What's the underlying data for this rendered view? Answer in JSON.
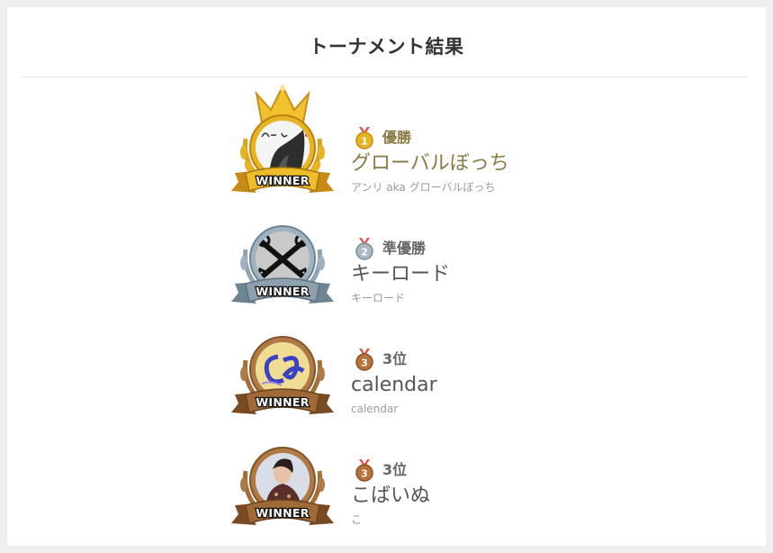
{
  "title": "トーナメント結果",
  "entries": [
    {
      "rank_label": "優勝",
      "name": "グローバルぼっち",
      "sub": "アンリ aka グローバルぼっち",
      "tier": "gold",
      "medal_number": "1",
      "badge_label": "WINNER",
      "colors": {
        "rank": "#8a7a45",
        "name": "#8a7a45",
        "rim": "#e8b425"
      }
    },
    {
      "rank_label": "準優勝",
      "name": "キーロード",
      "sub": "キーロード",
      "tier": "silver",
      "medal_number": "2",
      "badge_label": "WINNER",
      "colors": {
        "rank": "#666666",
        "name": "#555555",
        "rim": "#9fb2bf"
      }
    },
    {
      "rank_label": "3位",
      "name": "calendar",
      "sub": "calendar",
      "tier": "bronze",
      "medal_number": "3",
      "badge_label": "WINNER",
      "colors": {
        "rank": "#666666",
        "name": "#555555",
        "rim": "#b07a47"
      }
    },
    {
      "rank_label": "3位",
      "name": "こばいぬ",
      "sub": "こ",
      "tier": "bronze",
      "medal_number": "3",
      "badge_label": "WINNER",
      "colors": {
        "rank": "#666666",
        "name": "#555555",
        "rim": "#b07a47"
      }
    }
  ]
}
